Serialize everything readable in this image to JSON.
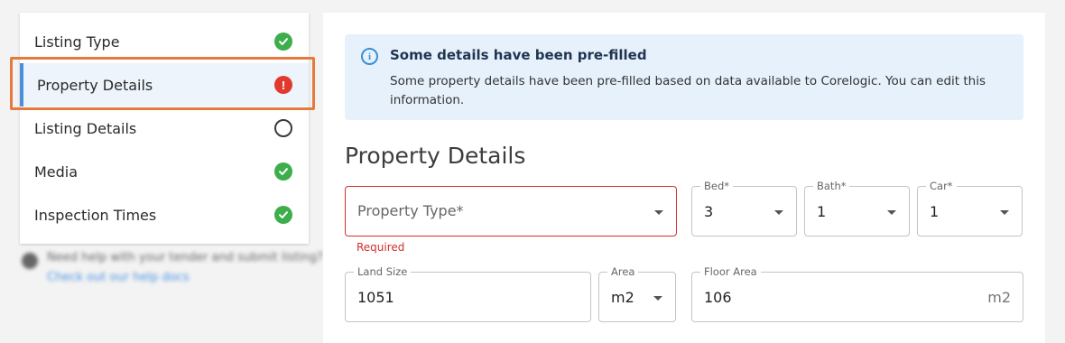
{
  "sidebar": {
    "items": [
      {
        "label": "Listing Type",
        "status": "complete"
      },
      {
        "label": "Property Details",
        "status": "error"
      },
      {
        "label": "Listing Details",
        "status": "incomplete"
      },
      {
        "label": "Media",
        "status": "complete"
      },
      {
        "label": "Inspection Times",
        "status": "complete"
      }
    ],
    "active_item": "Property Details",
    "error_glyph": "!"
  },
  "help": {
    "text": "Need help with your tender and submit listing?",
    "link": "Check out our help docs"
  },
  "info_banner": {
    "icon": "i",
    "title": "Some details have been pre-filled",
    "body": "Some property details have been pre-filled based on data available to Corelogic. You can edit this information."
  },
  "section_title": "Property Details",
  "fields": {
    "property_type": {
      "placeholder": "Property Type*",
      "error": "Required"
    },
    "bed": {
      "label": "Bed*",
      "value": "3"
    },
    "bath": {
      "label": "Bath*",
      "value": "1"
    },
    "car": {
      "label": "Car*",
      "value": "1"
    },
    "land_size": {
      "label": "Land Size",
      "value": "1051"
    },
    "area_unit": {
      "label": "Area",
      "value": "m2"
    },
    "floor_area": {
      "label": "Floor Area",
      "value": "106",
      "unit": "m2"
    }
  },
  "colors": {
    "complete": "#3dae4b",
    "error": "#e03a2e",
    "highlight": "#e57a3c",
    "info_bg": "#e6f1fb",
    "active_bar": "#4a90d9"
  }
}
